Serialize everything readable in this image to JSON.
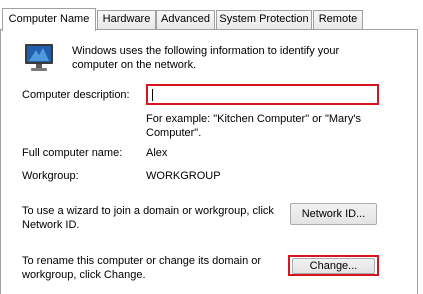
{
  "tabs": [
    {
      "label": "Computer Name",
      "active": true
    },
    {
      "label": "Hardware",
      "active": false
    },
    {
      "label": "Advanced",
      "active": false
    },
    {
      "label": "System Protection",
      "active": false
    },
    {
      "label": "Remote",
      "active": false
    }
  ],
  "intro_text": "Windows uses the following information to identify your computer on the network.",
  "description": {
    "label": "Computer description:",
    "value": "",
    "example": "For example: \"Kitchen Computer\" or \"Mary's Computer\"."
  },
  "full_name": {
    "label": "Full computer name:",
    "value": "Alex"
  },
  "workgroup": {
    "label": "Workgroup:",
    "value": "WORKGROUP"
  },
  "network_id": {
    "text": "To use a wizard to join a domain or workgroup, click Network ID.",
    "button_label": "Network ID..."
  },
  "rename": {
    "text": "To rename this computer or change its domain or workgroup, click Change.",
    "button_label": "Change..."
  },
  "colors": {
    "highlight": "#d9141e"
  }
}
